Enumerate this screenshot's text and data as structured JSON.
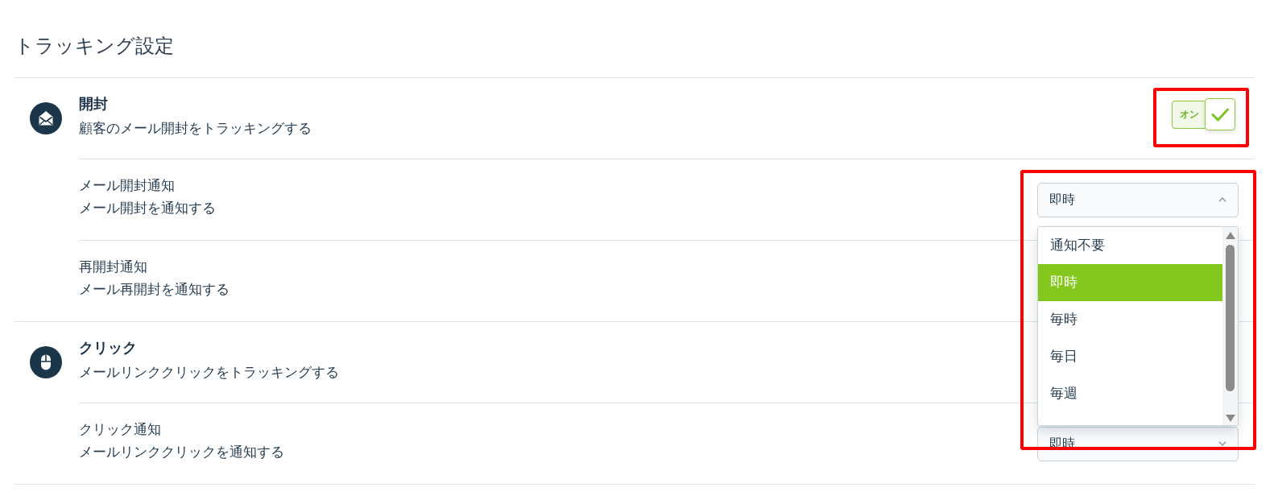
{
  "page": {
    "title": "トラッキング設定"
  },
  "sections": [
    {
      "kind": "open",
      "title": "開封",
      "description": "顧客のメール開封をトラッキングする",
      "toggle": {
        "label": "オン",
        "on": true,
        "highlighted": true
      },
      "settings": [
        {
          "label": "メール開封通知",
          "description": "メール開封を通知する",
          "select": {
            "value": "即時",
            "expanded": true,
            "highlighted": true,
            "options": [
              {
                "label": "通知不要",
                "selected": false
              },
              {
                "label": "即時",
                "selected": true
              },
              {
                "label": "毎時",
                "selected": false
              },
              {
                "label": "毎日",
                "selected": false
              },
              {
                "label": "毎週",
                "selected": false
              }
            ]
          }
        },
        {
          "label": "再開封通知",
          "description": "メール再開封を通知する"
        }
      ]
    },
    {
      "kind": "click",
      "title": "クリック",
      "description": "メールリンククリックをトラッキングする",
      "settings": [
        {
          "label": "クリック通知",
          "description": "メールリンククリックを通知する",
          "select": {
            "value": "即時",
            "expanded": false
          }
        }
      ]
    }
  ]
}
